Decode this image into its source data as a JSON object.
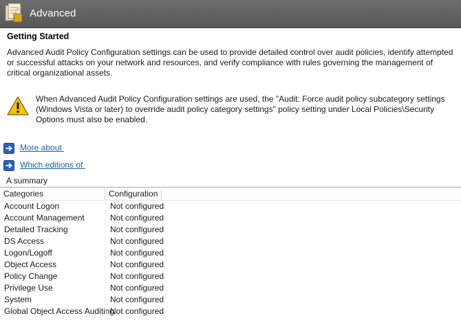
{
  "window": {
    "title": "Advanced"
  },
  "main": {
    "heading": "Getting Started",
    "description": "Advanced Audit Policy Configuration settings can be used to provide detailed control over audit policies, identify attempted or successful attacks on your network and resources, and verify compliance with rules governing the management of critical organizational assets.",
    "warning": "When Advanced Audit Policy Configuration settings are used, the \"Audit: Force audit policy subcategory settings (Windows Vista or later) to override audit policy category settings\" policy setting under Local Policies\\Security Options must also be enabled.",
    "links": [
      {
        "label": "More about ",
        "icon": "blue-arrow-icon"
      },
      {
        "label": "Which editions of ",
        "icon": "blue-arrow-icon"
      }
    ],
    "summary_label": "A summary"
  },
  "table": {
    "headers": [
      "Categories",
      "Configuration"
    ],
    "rows": [
      {
        "category": "Account Logon",
        "configuration": "Not configured"
      },
      {
        "category": "Account Management",
        "configuration": "Not configured"
      },
      {
        "category": "Detailed Tracking",
        "configuration": "Not configured"
      },
      {
        "category": "DS Access",
        "configuration": "Not configured"
      },
      {
        "category": "Logon/Logoff",
        "configuration": "Not configured"
      },
      {
        "category": "Object Access",
        "configuration": "Not configured"
      },
      {
        "category": "Policy Change",
        "configuration": "Not configured"
      },
      {
        "category": "Privilege Use",
        "configuration": "Not configured"
      },
      {
        "category": "System",
        "configuration": "Not configured"
      },
      {
        "category": "Global Object Access Auditing",
        "configuration": "Not configured"
      }
    ]
  },
  "colors": {
    "titlebar": "#5f5f5f",
    "link": "#1a5fa8",
    "warning": "#f5c400"
  },
  "icons": {
    "title": "policy-document-icon",
    "warning": "warning-icon"
  }
}
